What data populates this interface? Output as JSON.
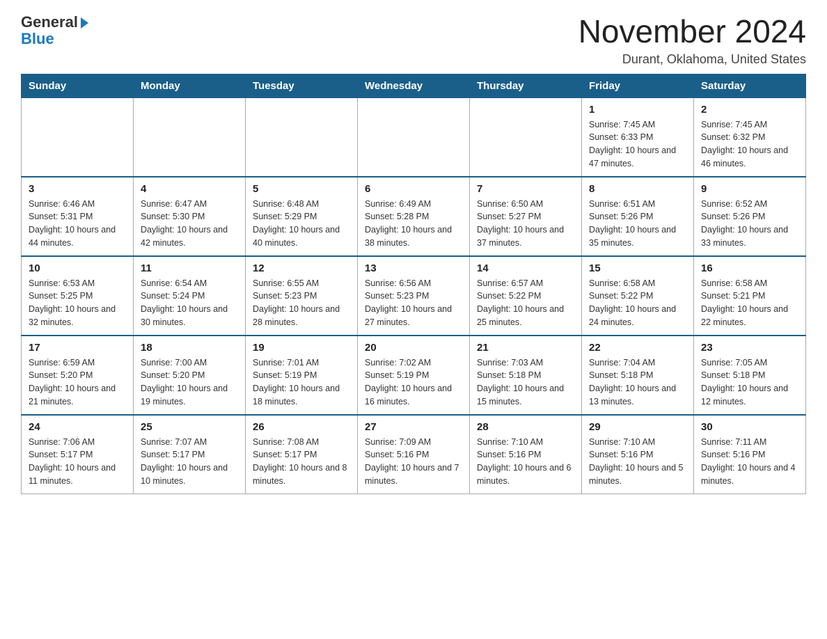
{
  "logo": {
    "text_general": "General",
    "text_blue": "Blue",
    "triangle_symbol": "▶"
  },
  "header": {
    "month_year": "November 2024",
    "location": "Durant, Oklahoma, United States"
  },
  "days_of_week": [
    "Sunday",
    "Monday",
    "Tuesday",
    "Wednesday",
    "Thursday",
    "Friday",
    "Saturday"
  ],
  "weeks": [
    [
      {
        "day": "",
        "info": ""
      },
      {
        "day": "",
        "info": ""
      },
      {
        "day": "",
        "info": ""
      },
      {
        "day": "",
        "info": ""
      },
      {
        "day": "",
        "info": ""
      },
      {
        "day": "1",
        "info": "Sunrise: 7:45 AM\nSunset: 6:33 PM\nDaylight: 10 hours and 47 minutes."
      },
      {
        "day": "2",
        "info": "Sunrise: 7:45 AM\nSunset: 6:32 PM\nDaylight: 10 hours and 46 minutes."
      }
    ],
    [
      {
        "day": "3",
        "info": "Sunrise: 6:46 AM\nSunset: 5:31 PM\nDaylight: 10 hours and 44 minutes."
      },
      {
        "day": "4",
        "info": "Sunrise: 6:47 AM\nSunset: 5:30 PM\nDaylight: 10 hours and 42 minutes."
      },
      {
        "day": "5",
        "info": "Sunrise: 6:48 AM\nSunset: 5:29 PM\nDaylight: 10 hours and 40 minutes."
      },
      {
        "day": "6",
        "info": "Sunrise: 6:49 AM\nSunset: 5:28 PM\nDaylight: 10 hours and 38 minutes."
      },
      {
        "day": "7",
        "info": "Sunrise: 6:50 AM\nSunset: 5:27 PM\nDaylight: 10 hours and 37 minutes."
      },
      {
        "day": "8",
        "info": "Sunrise: 6:51 AM\nSunset: 5:26 PM\nDaylight: 10 hours and 35 minutes."
      },
      {
        "day": "9",
        "info": "Sunrise: 6:52 AM\nSunset: 5:26 PM\nDaylight: 10 hours and 33 minutes."
      }
    ],
    [
      {
        "day": "10",
        "info": "Sunrise: 6:53 AM\nSunset: 5:25 PM\nDaylight: 10 hours and 32 minutes."
      },
      {
        "day": "11",
        "info": "Sunrise: 6:54 AM\nSunset: 5:24 PM\nDaylight: 10 hours and 30 minutes."
      },
      {
        "day": "12",
        "info": "Sunrise: 6:55 AM\nSunset: 5:23 PM\nDaylight: 10 hours and 28 minutes."
      },
      {
        "day": "13",
        "info": "Sunrise: 6:56 AM\nSunset: 5:23 PM\nDaylight: 10 hours and 27 minutes."
      },
      {
        "day": "14",
        "info": "Sunrise: 6:57 AM\nSunset: 5:22 PM\nDaylight: 10 hours and 25 minutes."
      },
      {
        "day": "15",
        "info": "Sunrise: 6:58 AM\nSunset: 5:22 PM\nDaylight: 10 hours and 24 minutes."
      },
      {
        "day": "16",
        "info": "Sunrise: 6:58 AM\nSunset: 5:21 PM\nDaylight: 10 hours and 22 minutes."
      }
    ],
    [
      {
        "day": "17",
        "info": "Sunrise: 6:59 AM\nSunset: 5:20 PM\nDaylight: 10 hours and 21 minutes."
      },
      {
        "day": "18",
        "info": "Sunrise: 7:00 AM\nSunset: 5:20 PM\nDaylight: 10 hours and 19 minutes."
      },
      {
        "day": "19",
        "info": "Sunrise: 7:01 AM\nSunset: 5:19 PM\nDaylight: 10 hours and 18 minutes."
      },
      {
        "day": "20",
        "info": "Sunrise: 7:02 AM\nSunset: 5:19 PM\nDaylight: 10 hours and 16 minutes."
      },
      {
        "day": "21",
        "info": "Sunrise: 7:03 AM\nSunset: 5:18 PM\nDaylight: 10 hours and 15 minutes."
      },
      {
        "day": "22",
        "info": "Sunrise: 7:04 AM\nSunset: 5:18 PM\nDaylight: 10 hours and 13 minutes."
      },
      {
        "day": "23",
        "info": "Sunrise: 7:05 AM\nSunset: 5:18 PM\nDaylight: 10 hours and 12 minutes."
      }
    ],
    [
      {
        "day": "24",
        "info": "Sunrise: 7:06 AM\nSunset: 5:17 PM\nDaylight: 10 hours and 11 minutes."
      },
      {
        "day": "25",
        "info": "Sunrise: 7:07 AM\nSunset: 5:17 PM\nDaylight: 10 hours and 10 minutes."
      },
      {
        "day": "26",
        "info": "Sunrise: 7:08 AM\nSunset: 5:17 PM\nDaylight: 10 hours and 8 minutes."
      },
      {
        "day": "27",
        "info": "Sunrise: 7:09 AM\nSunset: 5:16 PM\nDaylight: 10 hours and 7 minutes."
      },
      {
        "day": "28",
        "info": "Sunrise: 7:10 AM\nSunset: 5:16 PM\nDaylight: 10 hours and 6 minutes."
      },
      {
        "day": "29",
        "info": "Sunrise: 7:10 AM\nSunset: 5:16 PM\nDaylight: 10 hours and 5 minutes."
      },
      {
        "day": "30",
        "info": "Sunrise: 7:11 AM\nSunset: 5:16 PM\nDaylight: 10 hours and 4 minutes."
      }
    ]
  ]
}
